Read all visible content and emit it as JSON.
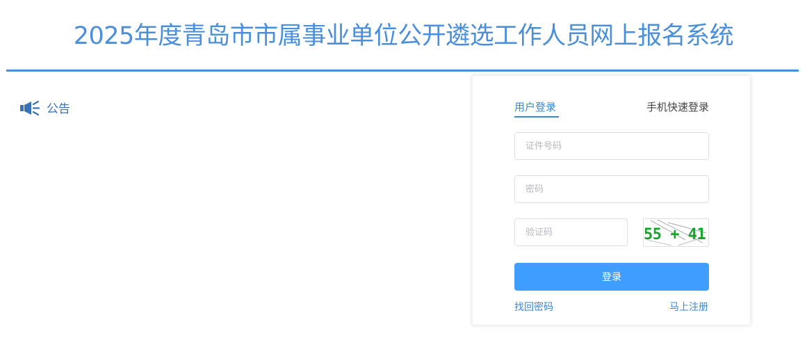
{
  "header": {
    "title": "2025年度青岛市市属事业单位公开遴选工作人员网上报名系统"
  },
  "notice": {
    "label": "公告",
    "icon": "megaphone-icon"
  },
  "login": {
    "tabs": {
      "user": "用户登录",
      "phone": "手机快速登录"
    },
    "fields": {
      "id_placeholder": "证件号码",
      "password_placeholder": "密码",
      "captcha_placeholder": "验证码"
    },
    "captcha_text": "55 + 41 = ?",
    "submit_label": "登录",
    "forgot_label": "找回密码",
    "register_label": "马上注册"
  },
  "colors": {
    "brand_blue": "#4a8fdb",
    "button_blue": "#409eff",
    "link_blue": "#3a87d6",
    "captcha_green": "#16a32a"
  }
}
